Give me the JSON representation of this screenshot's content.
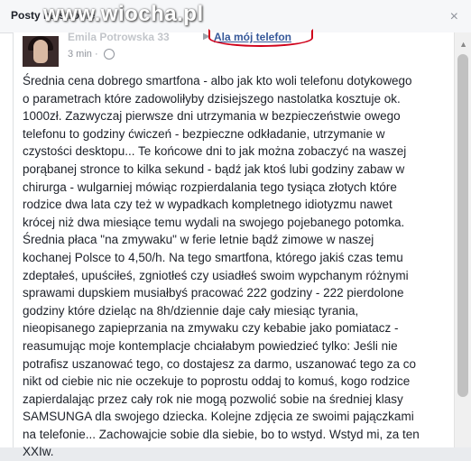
{
  "header": {
    "title": "Posty na stronie",
    "watermark": "www.wiocha.pl",
    "close_glyph": "×"
  },
  "post": {
    "author_name": "Emila Potrowska 33",
    "arrow": "▶",
    "target_page": "Ala mój telefon",
    "time": "3 min ·",
    "text": "Średnia cena dobrego smartfona - albo jak kto woli telefonu dotykowego o parametrach które zadowoliłyby dzisiejszego nastolatka kosztuje ok. 1000zł. Zazwyczaj pierwsze dni utrzymania w bezpieczeństwie owego telefonu to godziny ćwiczeń - bezpieczne odkładanie, utrzymanie w czystości desktopu... Te końcowe dni to jak można zobaczyć na waszej porąbanej stronce to kilka sekund - bądź jak ktoś lubi godziny zabaw w chirurga - wulgarniej mówiąc rozpierdalania tego tysiąca złotych które rodzice dwa lata czy też w wypadkach kompletnego idiotyzmu nawet krócej niż dwa miesiące temu wydali na swojego pojebanego potomka. Średnia płaca \"na zmywaku\" w ferie letnie bądź zimowe w naszej kochanej Polsce to 4,50/h. Na tego smartfona, którego jakiś czas temu zdeptałeś, upuściłeś, zgniotłeś czy usiadłeś swoim wypchanym różnymi sprawami dupskiem musiałbyś pracować 222 godziny - 222 pierdolone godziny które dzieląc na 8h/dziennie daje cały miesiąc tyrania, nieopisanego zapieprzania na zmywaku czy kebabie jako pomiatacz - reasumując moje kontemplacje chciałabym powiedzieć tylko: Jeśli nie potrafisz uszanować tego, co dostajesz za darmo, uszanować tego za co nikt od ciebie nic nie oczekuje to poprostu oddaj to komuś, kogo rodzice zapierdalając przez cały rok nie mogą pozwolić sobie na średniej klasy SAMSUNGA dla swojego dziecka. Kolejne zdjęcia ze swoimi pajączkami na telefonie... Zachowajcie sobie dla siebie, bo to wstyd. Wstyd mi, za ten XXIw."
  },
  "scrollbar": {
    "up_glyph": "▲"
  },
  "icons": {
    "close": "close-icon",
    "globe": "globe-icon",
    "avatar": "avatar"
  }
}
